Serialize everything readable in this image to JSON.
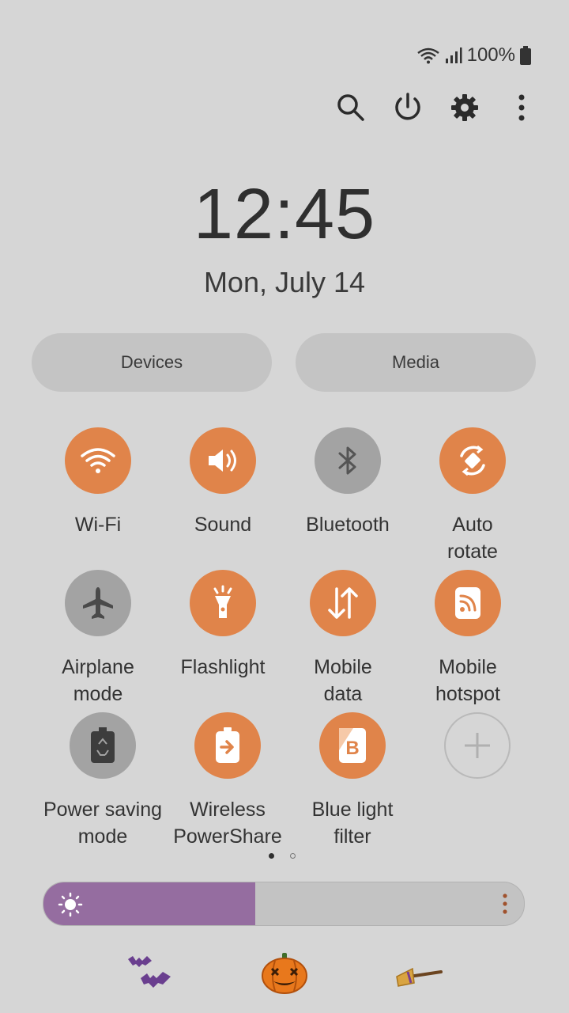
{
  "status_bar": {
    "battery_text": "100%",
    "icons": [
      "wifi-icon",
      "signal-icon",
      "battery-icon"
    ]
  },
  "toolbar": {
    "icons": [
      "search-icon",
      "power-icon",
      "settings-icon",
      "more-vert-icon"
    ]
  },
  "clock": {
    "time": "12:45",
    "date": "Mon, July 14"
  },
  "pills": {
    "devices": "Devices",
    "media": "Media"
  },
  "tiles": [
    {
      "label": "Wi-Fi",
      "state": "on",
      "icon": "wifi-icon"
    },
    {
      "label": "Sound",
      "state": "on",
      "icon": "volume-icon"
    },
    {
      "label": "Bluetooth",
      "state": "off",
      "icon": "bluetooth-icon"
    },
    {
      "label": "Auto\nrotate",
      "state": "on",
      "icon": "rotate-icon"
    },
    {
      "label": "Airplane\nmode",
      "state": "off",
      "icon": "airplane-icon"
    },
    {
      "label": "Flashlight",
      "state": "on",
      "icon": "flashlight-icon"
    },
    {
      "label": "Mobile\ndata",
      "state": "on",
      "icon": "mobile-data-icon"
    },
    {
      "label": "Mobile\nhotspot",
      "state": "on",
      "icon": "hotspot-icon"
    },
    {
      "label": "Power saving\nmode",
      "state": "off",
      "icon": "power-saving-icon"
    },
    {
      "label": "Wireless\nPowerShare",
      "state": "on",
      "icon": "powershare-icon"
    },
    {
      "label": "Blue light\nfilter",
      "state": "on",
      "icon": "blue-light-icon"
    },
    {
      "label": "",
      "state": "add",
      "icon": "add-icon"
    }
  ],
  "pager": {
    "pages": 2,
    "current": 1
  },
  "brightness": {
    "level": 0.44
  },
  "colors": {
    "accent": "#e0844a",
    "off": "#a3a3a3",
    "brightness_fill": "#956da0",
    "background": "#d6d6d6"
  },
  "decorations": [
    "bats-icon",
    "pumpkin-icon",
    "broom-icon"
  ]
}
